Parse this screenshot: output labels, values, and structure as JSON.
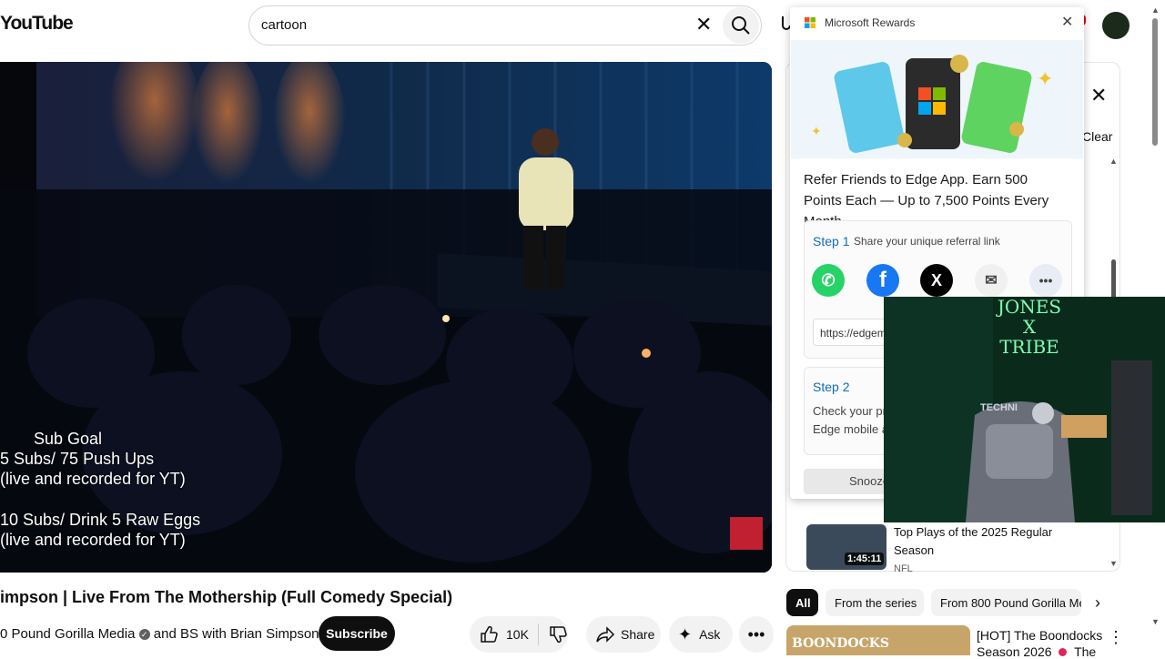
{
  "header": {
    "logo_text": "YouTube",
    "search_value": "cartoon"
  },
  "player": {
    "overlay": {
      "heading": "Sub Goal",
      "line1": "5 Subs/ 75 Push Ups",
      "line2": "(live and recorded for YT)",
      "line3": "10 Subs/ Drink 5 Raw Eggs",
      "line4": "(live and recorded for YT)"
    }
  },
  "video": {
    "title": "impson | Live From The Mothership (Full Comedy Special)",
    "channel": "0 Pound Gorilla Media",
    "channel_suffix": "and BS with Brian Simpson",
    "subscribe_label": "Subscribe",
    "like_count": "10K",
    "share_label": "Share",
    "ask_label": "Ask"
  },
  "panel": {
    "clear_label": "Clear"
  },
  "rewards": {
    "title": "Microsoft Rewards",
    "headline": "Refer Friends to Edge App. Earn 500 Points Each — Up to 7,500 Points Every Month.",
    "step1_label": "Step 1",
    "step1_text": "Share your unique referral link",
    "link_text": "https://edgem",
    "step2_label": "Step 2",
    "step2_text1": "Check your pr",
    "step2_text2": "Edge mobile a",
    "snooze_label": "Snooze"
  },
  "webcam": {
    "sign_line1": "JONES",
    "sign_line2": "X",
    "sign_line3": "TRIBE",
    "chair_text": "TECHNI"
  },
  "suggestion": {
    "duration": "1:45:11",
    "title_line1": "Top Plays of the 2025 Regular",
    "title_line2": "Season",
    "channel": "NFL"
  },
  "chips": [
    "All",
    "From the series",
    "From 800 Pound Gorilla Me"
  ],
  "bottom_video": {
    "title_line1": "[HOT] The Boondocks",
    "title_line2": "Season 2026",
    "title_suffix": "The",
    "thumb_text": "BOONDOCKS"
  },
  "colors": {
    "brand_red": "#ff0000",
    "link_blue": "#0f6cbd",
    "whatsapp": "#25d366",
    "facebook": "#1877f2"
  }
}
